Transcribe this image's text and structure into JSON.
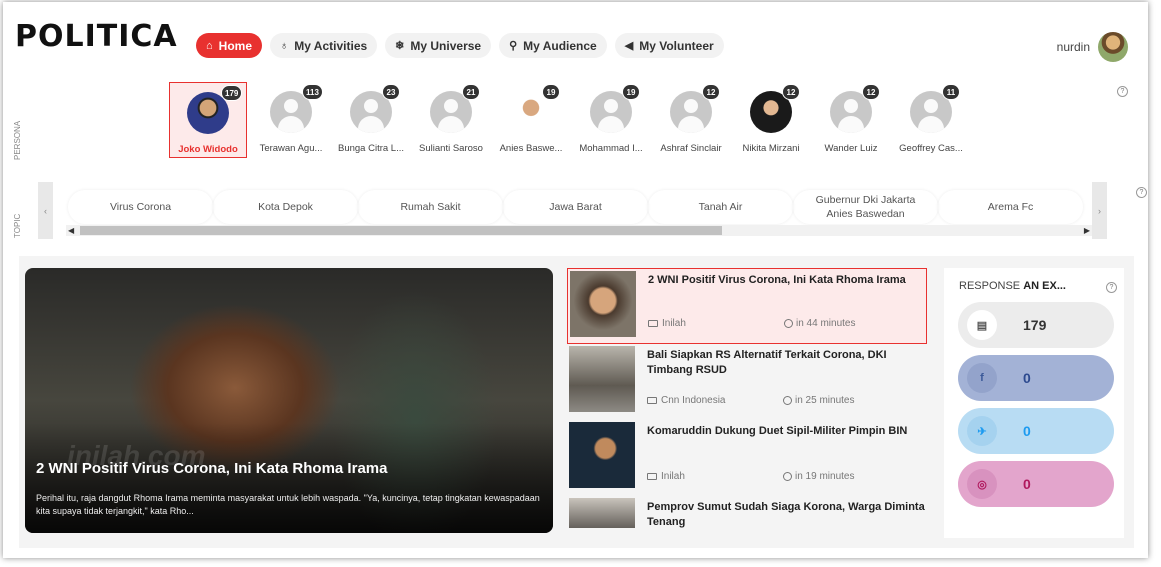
{
  "brand": {
    "logo": "POLITICA"
  },
  "nav": {
    "items": [
      {
        "label": "Home",
        "icon": "home-icon",
        "glyph": "⌂"
      },
      {
        "label": "My Activities",
        "icon": "activity-icon",
        "glyph": "♁"
      },
      {
        "label": "My Universe",
        "icon": "universe-icon",
        "glyph": "❄"
      },
      {
        "label": "My Audience",
        "icon": "audience-icon",
        "glyph": "⚲"
      },
      {
        "label": "My Volunteer",
        "icon": "megaphone-icon",
        "glyph": "◀"
      }
    ]
  },
  "user": {
    "name": "nurdin"
  },
  "people": [
    {
      "name": "Joko Widodo",
      "count": "179"
    },
    {
      "name": "Terawan Agu...",
      "count": "113"
    },
    {
      "name": "Bunga Citra L...",
      "count": "23"
    },
    {
      "name": "Sulianti Saroso",
      "count": "21"
    },
    {
      "name": "Anies Baswe...",
      "count": "19"
    },
    {
      "name": "Mohammad I...",
      "count": "19"
    },
    {
      "name": "Ashraf Sinclair",
      "count": "12"
    },
    {
      "name": "Nikita Mirzani",
      "count": "12"
    },
    {
      "name": "Wander Luiz",
      "count": "12"
    },
    {
      "name": "Geoffrey Cas...",
      "count": "11"
    }
  ],
  "topics": [
    "Virus Corona",
    "Kota Depok",
    "Rumah Sakit",
    "Jawa Barat",
    "Tanah Air",
    "Gubernur Dki Jakarta Anies Baswedan",
    "Arema Fc"
  ],
  "hero": {
    "watermark": "inilah.com",
    "title": "2 WNI Positif Virus Corona, Ini Kata Rhoma Irama",
    "description": "Perihal itu, raja dangdut Rhoma Irama meminta masyarakat untuk lebih waspada. \"Ya, kuncinya, tetap tingkatan kewaspadaan kita supaya tidak terjangkit,\" kata Rho..."
  },
  "news": [
    {
      "title": "2 WNI Positif Virus Corona, Ini Kata Rhoma Irama",
      "source": "Inilah",
      "time": "in 44 minutes"
    },
    {
      "title": "Bali Siapkan RS Alternatif Terkait Corona, DKI Timbang RSUD",
      "source": "Cnn Indonesia",
      "time": "in 25 minutes"
    },
    {
      "title": "Komaruddin Dukung Duet Sipil-Militer Pimpin BIN",
      "source": "Inilah",
      "time": "in 19 minutes"
    },
    {
      "title": "Pemprov Sumut Sudah Siaga Korona, Warga Diminta Tenang",
      "source": "",
      "time": ""
    }
  ],
  "response": {
    "label": "RESPONSE",
    "target": "AN EX...",
    "rows": [
      {
        "icon": "news-icon",
        "glyph": "▤",
        "value": "179",
        "bg": "#ececec",
        "fg": "#333333",
        "iconbg": "#ffffff",
        "iconfg": "#555555"
      },
      {
        "icon": "facebook-icon",
        "glyph": "f",
        "value": "0",
        "bg": "#a3b2d6",
        "fg": "#2d4a8f",
        "iconbg": "#93a3cb",
        "iconfg": "#3b5998"
      },
      {
        "icon": "twitter-icon",
        "glyph": "✈",
        "value": "0",
        "bg": "#b8dcf3",
        "fg": "#1d9bf0",
        "iconbg": "#a5d2ef",
        "iconfg": "#1d9bf0"
      },
      {
        "icon": "instagram-icon",
        "glyph": "◎",
        "value": "0",
        "bg": "#e3a5cc",
        "fg": "#b0195e",
        "iconbg": "#d892bf",
        "iconfg": "#b0195e"
      }
    ]
  },
  "colors": {
    "accent": "#e8312f",
    "active_bg": "#fdeaea"
  }
}
